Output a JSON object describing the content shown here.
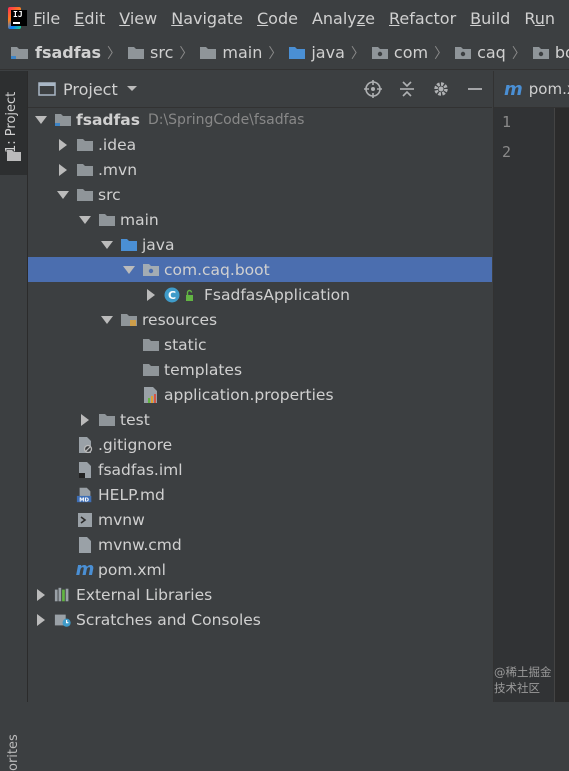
{
  "menu": [
    "File",
    "Edit",
    "View",
    "Navigate",
    "Code",
    "Analyze",
    "Refactor",
    "Build",
    "Run"
  ],
  "menu_mnemonics": [
    "F",
    "E",
    "V",
    "N",
    "C",
    "z",
    "R",
    "B",
    "u"
  ],
  "breadcrumb": [
    "fsadfas",
    "src",
    "main",
    "java",
    "com",
    "caq",
    "boot"
  ],
  "left_strip": {
    "project_tab": "1: Project",
    "bottom_tab": "orites"
  },
  "panel": {
    "title": "Project"
  },
  "tree": [
    {
      "label": "fsadfas",
      "hint": "D:\\SpringCode\\fsadfas",
      "depth": 0,
      "arrow": "down",
      "icon": "module-folder-icon",
      "bold": true
    },
    {
      "label": ".idea",
      "depth": 1,
      "arrow": "right",
      "icon": "folder-icon"
    },
    {
      "label": ".mvn",
      "depth": 1,
      "arrow": "right",
      "icon": "folder-icon"
    },
    {
      "label": "src",
      "depth": 1,
      "arrow": "down",
      "icon": "folder-icon"
    },
    {
      "label": "main",
      "depth": 2,
      "arrow": "down",
      "icon": "folder-icon"
    },
    {
      "label": "java",
      "depth": 3,
      "arrow": "down",
      "icon": "source-folder-icon"
    },
    {
      "label": "com.caq.boot",
      "depth": 4,
      "arrow": "down",
      "icon": "package-icon",
      "selected": true
    },
    {
      "label": "FsadfasApplication",
      "depth": 5,
      "arrow": "right",
      "icon": "java-class-icon"
    },
    {
      "label": "resources",
      "depth": 3,
      "arrow": "down",
      "icon": "resources-folder-icon"
    },
    {
      "label": "static",
      "depth": 4,
      "arrow": "none",
      "icon": "folder-icon"
    },
    {
      "label": "templates",
      "depth": 4,
      "arrow": "none",
      "icon": "folder-icon"
    },
    {
      "label": "application.properties",
      "depth": 4,
      "arrow": "none",
      "icon": "properties-file-icon"
    },
    {
      "label": "test",
      "depth": 2,
      "arrow": "right",
      "icon": "folder-icon"
    },
    {
      "label": ".gitignore",
      "depth": 1,
      "arrow": "none",
      "icon": "gitignore-file-icon"
    },
    {
      "label": "fsadfas.iml",
      "depth": 1,
      "arrow": "none",
      "icon": "iml-file-icon"
    },
    {
      "label": "HELP.md",
      "depth": 1,
      "arrow": "none",
      "icon": "markdown-file-icon"
    },
    {
      "label": "mvnw",
      "depth": 1,
      "arrow": "none",
      "icon": "script-file-icon"
    },
    {
      "label": "mvnw.cmd",
      "depth": 1,
      "arrow": "none",
      "icon": "file-icon"
    },
    {
      "label": "pom.xml",
      "depth": 1,
      "arrow": "none",
      "icon": "maven-file-icon"
    },
    {
      "label": "External Libraries",
      "depth": 0,
      "arrow": "right",
      "icon": "libraries-icon"
    },
    {
      "label": "Scratches and Consoles",
      "depth": 0,
      "arrow": "right",
      "icon": "scratches-icon"
    }
  ],
  "editor": {
    "tab_label": "pom.x",
    "tab_icon": "maven-file-icon",
    "line_numbers": [
      "1",
      "2"
    ]
  },
  "watermark": "@稀土掘金技术社区",
  "colors": {
    "background": "#3c3f41",
    "editor_bg": "#2b2b2b",
    "selection": "#4b6eaf",
    "folder": "#8f9599",
    "source_folder": "#4a8fd4",
    "maven_m": "#4a8fd4"
  }
}
